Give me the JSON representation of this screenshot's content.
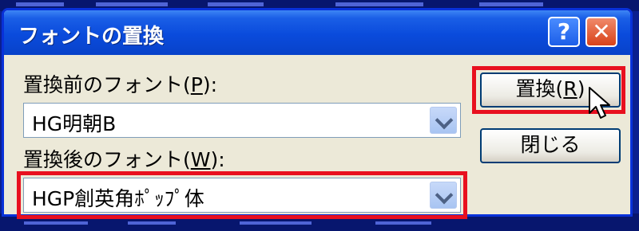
{
  "dialog": {
    "title": "フォントの置換",
    "help_label": "?",
    "close_label": "✕"
  },
  "source": {
    "label": "置換前のフォント(",
    "accel": "P",
    "label_end": "):",
    "value": "HG明朝B"
  },
  "target": {
    "label": "置換後のフォント(",
    "accel": "W",
    "label_end": "):",
    "value": "HGP創英角ﾎﾟｯﾌﾟ体"
  },
  "buttons": {
    "replace_label": "置換(",
    "replace_accel": "R",
    "replace_end": ")",
    "close_label": "閉じる"
  },
  "colors": {
    "highlight": "#e8101f",
    "titlebar": "#0a4bdc"
  },
  "icons": [
    "question-icon",
    "close-icon",
    "chevron-down-icon",
    "mouse-pointer-icon"
  ]
}
